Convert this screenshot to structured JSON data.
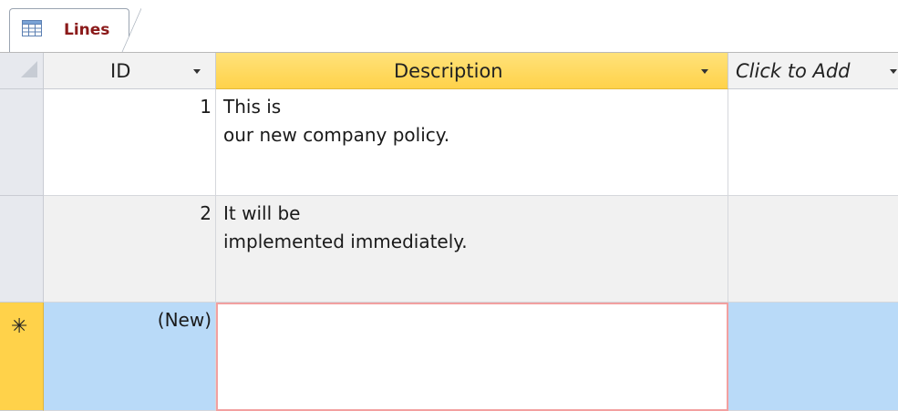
{
  "tab": {
    "label": "Lines",
    "icon": "table-icon"
  },
  "columns": {
    "id": "ID",
    "description": "Description",
    "add": "Click to Add"
  },
  "rows": [
    {
      "id": "1",
      "description": [
        "This is",
        "our new company policy."
      ]
    },
    {
      "id": "2",
      "description": [
        "It will be",
        "implemented immediately."
      ]
    }
  ],
  "new_row": {
    "marker": "✳",
    "id": "(New)",
    "description": ""
  },
  "colors": {
    "accent": "#ffd24a",
    "selection_row": "#b9daf8",
    "tab_label": "#8b1a1a",
    "focus_border": "#f2a0a0"
  }
}
